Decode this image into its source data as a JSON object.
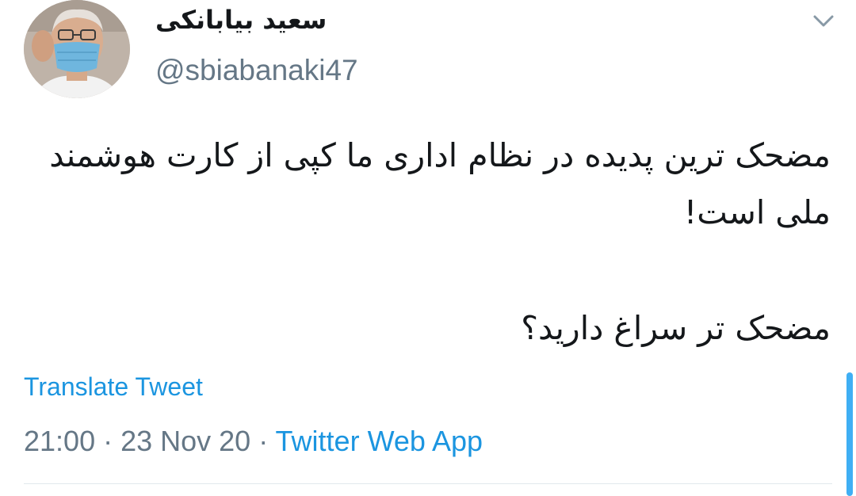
{
  "user": {
    "display_name": "سعید بیابانکی",
    "handle": "@sbiabanaki47"
  },
  "tweet": {
    "paragraph_1": "مضحک ترین پدیده در نظام اداری ما کپی از کارت هوشمند ملی است!",
    "paragraph_2": "مضحک تر سراغ دارید؟"
  },
  "translate_label": "Translate Tweet",
  "meta": {
    "time": "21:00",
    "separator": " · ",
    "date": "23 Nov 20",
    "source": "Twitter Web App"
  },
  "icons": {
    "menu": "chevron-down-icon",
    "avatar": "avatar-photo"
  },
  "colors": {
    "link": "#1b95e0",
    "text": "#14171a",
    "secondary": "#657786",
    "divider": "#e1e8ed"
  }
}
